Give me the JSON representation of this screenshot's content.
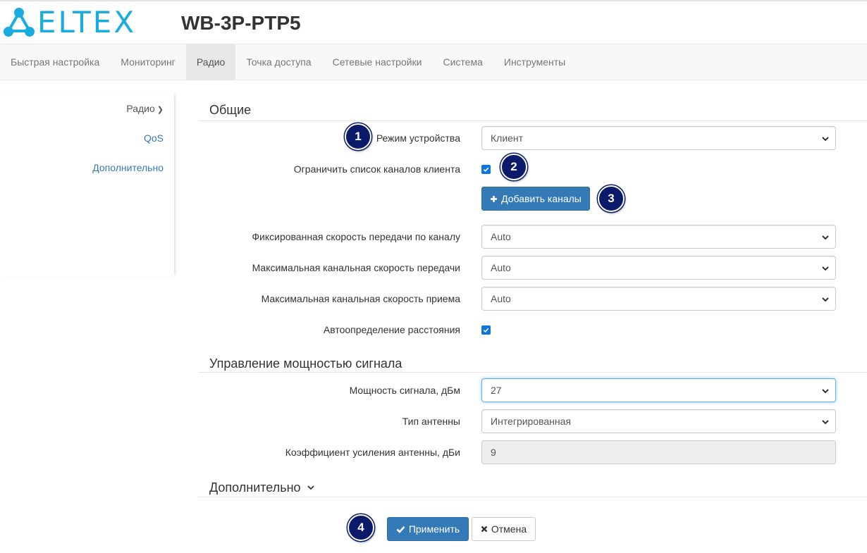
{
  "brand": {
    "logo_text": "ELTEX",
    "color": "#1aace0"
  },
  "device": {
    "title": "WB-3P-PTP5"
  },
  "nav": {
    "items": [
      {
        "label": "Быстрая настройка"
      },
      {
        "label": "Мониторинг"
      },
      {
        "label": "Радио"
      },
      {
        "label": "Точка доступа"
      },
      {
        "label": "Сетевые настройки"
      },
      {
        "label": "Система"
      },
      {
        "label": "Инструменты"
      }
    ],
    "active": "Радио"
  },
  "sidebar": {
    "items": [
      {
        "label": "Радио"
      },
      {
        "label": "QoS"
      },
      {
        "label": "Дополнительно"
      }
    ]
  },
  "general": {
    "title": "Общие",
    "device_mode": {
      "label": "Режим устройства",
      "value": "Клиент"
    },
    "limit_channels": {
      "label": "Ограничить список каналов клиента",
      "checked": true
    },
    "add_channels_label": "Добавить каналы",
    "fixed_rate": {
      "label": "Фиксированная скорость передачи по каналу",
      "value": "Auto"
    },
    "max_tx_rate": {
      "label": "Максимальная канальная скорость передачи",
      "value": "Auto"
    },
    "max_rx_rate": {
      "label": "Максимальная канальная скорость приема",
      "value": "Auto"
    },
    "auto_distance": {
      "label": "Автоопределение расстояния",
      "checked": true
    }
  },
  "power": {
    "title": "Управление мощностью сигнала",
    "signal_power": {
      "label": "Мощность сигнала, дБм",
      "value": "27"
    },
    "antenna_type": {
      "label": "Тип антенны",
      "value": "Интегрированная"
    },
    "antenna_gain": {
      "label": "Коэффициент усиления антенны, дБи",
      "value": "9"
    }
  },
  "extra": {
    "title": "Дополнительно"
  },
  "actions": {
    "apply_label": "Применить",
    "cancel_label": "Отмена"
  },
  "badges": [
    "1",
    "2",
    "3",
    "4"
  ],
  "colors": {
    "primary": "#337ab7",
    "badge": "#0b1a6b",
    "checkbox": "#0b75e0"
  }
}
